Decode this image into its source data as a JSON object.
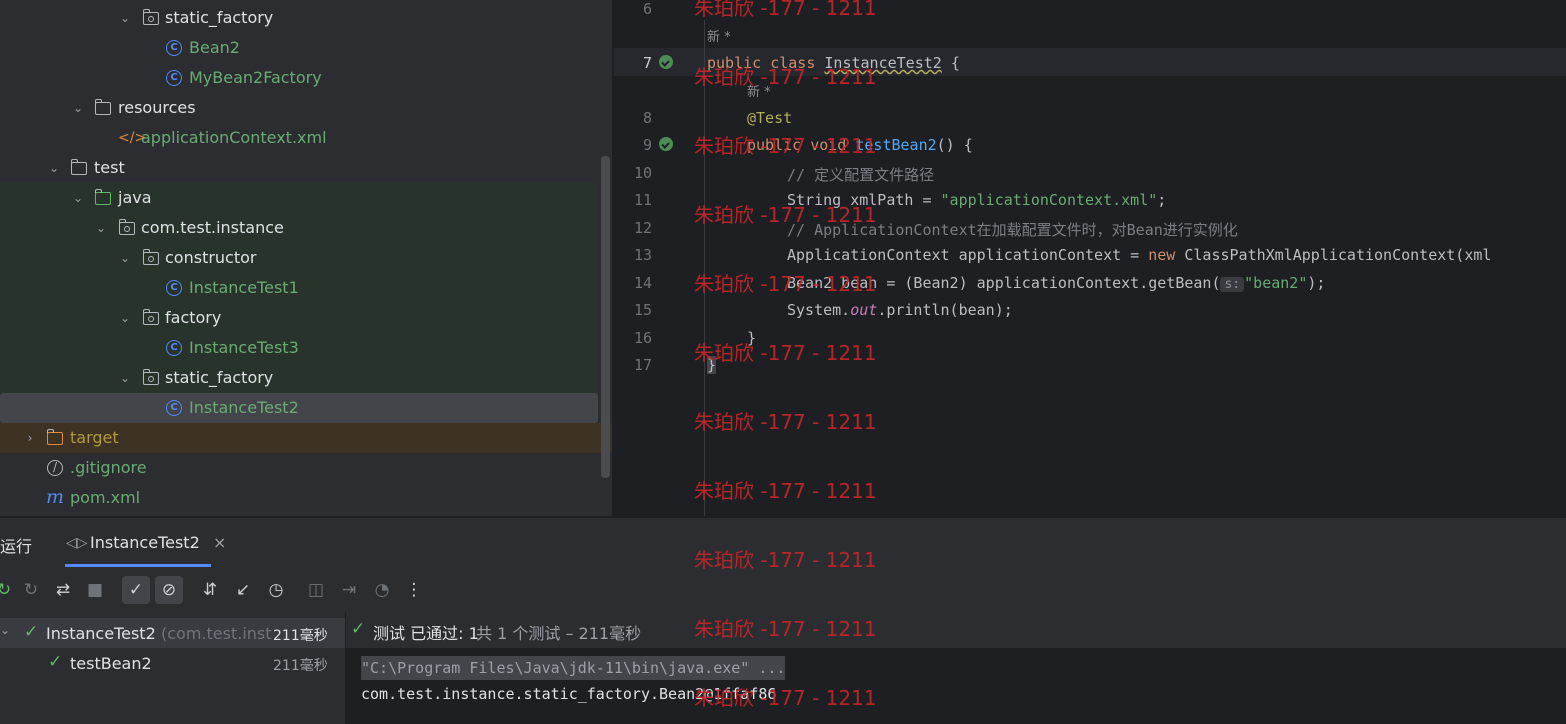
{
  "tree": {
    "items": [
      {
        "label": "static_factory",
        "type": "package",
        "depth": 3,
        "expanded": true
      },
      {
        "label": "Bean2",
        "type": "class",
        "depth": 4
      },
      {
        "label": "MyBean2Factory",
        "type": "class",
        "depth": 4
      },
      {
        "label": "resources",
        "type": "folder",
        "depth": 2,
        "expanded": true
      },
      {
        "label": "applicationContext.xml",
        "type": "xml",
        "depth": 3
      },
      {
        "label": "test",
        "type": "folder",
        "depth": 1,
        "expanded": true
      },
      {
        "label": "java",
        "type": "folder",
        "depth": 2,
        "expanded": true
      },
      {
        "label": "com.test.instance",
        "type": "package",
        "depth": 3,
        "expanded": true
      },
      {
        "label": "constructor",
        "type": "package",
        "depth": 4,
        "expanded": true
      },
      {
        "label": "InstanceTest1",
        "type": "class",
        "depth": 5
      },
      {
        "label": "factory",
        "type": "package",
        "depth": 4,
        "expanded": true
      },
      {
        "label": "InstanceTest3",
        "type": "class",
        "depth": 5
      },
      {
        "label": "static_factory",
        "type": "package",
        "depth": 4,
        "expanded": true
      },
      {
        "label": "InstanceTest2",
        "type": "class",
        "depth": 5,
        "selected": true
      },
      {
        "label": "target",
        "type": "folder",
        "depth": 0,
        "expanded": false
      },
      {
        "label": ".gitignore",
        "type": "ignore",
        "depth": 0
      },
      {
        "label": "pom.xml",
        "type": "maven",
        "depth": 0
      }
    ]
  },
  "editor": {
    "line_numbers": [
      "6",
      "7",
      "8",
      "9",
      "10",
      "11",
      "12",
      "13",
      "14",
      "15",
      "16",
      "17"
    ],
    "hint_new": "新 *",
    "line7": {
      "kw1": "public",
      "kw2": "class",
      "name": "InstanceTest2",
      "brace": " {"
    },
    "line8": {
      "annotation": "@Test"
    },
    "line9": {
      "kw1": "public",
      "kw2": "void",
      "method": "testBean2",
      "rest": "() {"
    },
    "line10": "// 定义配置文件路径",
    "line11": {
      "type": "String xmlPath = ",
      "value": "\"applicationContext.xml\"",
      "end": ";"
    },
    "line12": "// ApplicationContext在加载配置文件时，对Bean进行实例化",
    "line13": {
      "pre": "ApplicationContext applicationContext = ",
      "kw": "new",
      "post": " ClassPathXmlApplicationContext(xml"
    },
    "line14": {
      "pre": "Bean2 bean = (Bean2) applicationContext.getBean(",
      "hint": "s:",
      "value": "\"bean2\"",
      "end": ");"
    },
    "line15": {
      "pre": "System.",
      "field": "out",
      "post": ".println(bean);"
    },
    "line16": "}",
    "line17": "}"
  },
  "watermark": "朱珀欣 -177 - 1211",
  "run": {
    "tab_run": "运行",
    "tab_config": "InstanceTest2",
    "tests": {
      "root": {
        "name": "InstanceTest2",
        "pkg": "(com.test.inst",
        "time": "211毫秒"
      },
      "child": {
        "name": "testBean2",
        "time": "211毫秒"
      }
    },
    "status": {
      "prefix": "测试 已通过: 1",
      "suffix": "共 1 个测试 – 211毫秒"
    },
    "console": [
      "\"C:\\Program Files\\Java\\jdk-11\\bin\\java.exe\" ...",
      "com.test.instance.static_factory.Bean2@1ffaf86"
    ]
  },
  "colors": {
    "accent": "#548af7",
    "pass": "#5fb865",
    "watermark": "#c7262a"
  }
}
